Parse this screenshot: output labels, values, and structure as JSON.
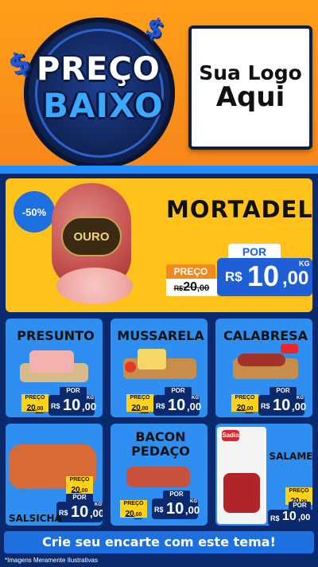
{
  "header": {
    "title_top": "PREÇO",
    "title_bottom": "BAIXO",
    "logo_line1": "Sua Logo",
    "logo_line2": "Aqui",
    "dollar_symbol": "$"
  },
  "featured": {
    "discount": "-50%",
    "brand_label": "OURO",
    "name": "MORTADELA",
    "preco_label": "PREÇO",
    "old_currency": "R$",
    "old_int": "20",
    "old_dec": ",00",
    "por_label": "POR",
    "currency": "R$",
    "price_int": "10",
    "price_dec": ",00",
    "unit": "KG"
  },
  "products": [
    {
      "name": "PRESUNTO",
      "preco_label": "PREÇO",
      "old_int": "20",
      "old_dec": ",00",
      "por_label": "POR",
      "currency": "R$",
      "price_int": "10",
      "price_dec": ",00",
      "unit": "KG"
    },
    {
      "name": "MUSSARELA",
      "preco_label": "PREÇO",
      "old_int": "20",
      "old_dec": ",00",
      "por_label": "POR",
      "currency": "R$",
      "price_int": "10",
      "price_dec": ",00",
      "unit": "KG"
    },
    {
      "name": "CALABRESA",
      "preco_label": "PREÇO",
      "old_int": "20",
      "old_dec": ",00",
      "por_label": "POR",
      "currency": "R$",
      "price_int": "10",
      "price_dec": ",00",
      "unit": "KG"
    },
    {
      "name": "SALSICHA",
      "preco_label": "PREÇO",
      "old_int": "20",
      "old_dec": ",00",
      "por_label": "POR",
      "currency": "R$",
      "price_int": "10",
      "price_dec": ",00",
      "unit": "KG"
    },
    {
      "name_line1": "BACON",
      "name_line2": "PEDAÇO",
      "preco_label": "PREÇO",
      "old_int": "20",
      "old_dec": ",00",
      "por_label": "POR",
      "currency": "R$",
      "price_int": "10",
      "price_dec": ",00",
      "unit": "KG"
    },
    {
      "name": "SALAME",
      "brand": "Sadia",
      "preco_label": "PREÇO",
      "old_int": "20",
      "old_dec": ",00",
      "por_label": "POR",
      "currency": "R$",
      "price_int": "10",
      "price_dec": ",00",
      "unit": "KG"
    }
  ],
  "cta": "Crie seu encarte com este tema!",
  "footnote": "*Imagens Meramente Ilustrativas",
  "colors": {
    "header_orange": "#f7861a",
    "navy": "#0b2a6e",
    "blue": "#1e5fd6",
    "yellow": "#ffc21a",
    "card_blue": "#2e8ff0"
  }
}
